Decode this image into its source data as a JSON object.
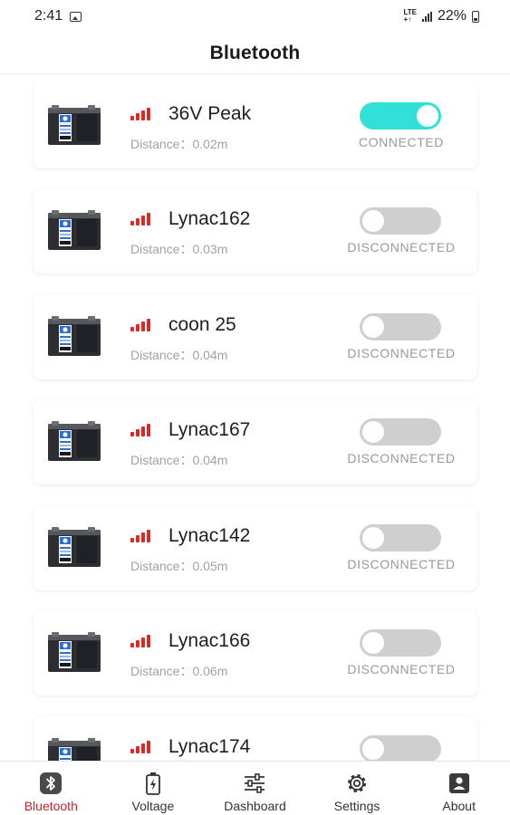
{
  "status_bar": {
    "time": "2:41",
    "lte_top": "LTE",
    "lte_bottom": "+↑",
    "battery": "22%"
  },
  "header": {
    "title": "Bluetooth"
  },
  "devices": [
    {
      "name": "36V Peak",
      "distance": "Distance：0.02m",
      "state": "CONNECTED",
      "connected": true
    },
    {
      "name": "Lynac162",
      "distance": "Distance：0.03m",
      "state": "DISCONNECTED",
      "connected": false
    },
    {
      "name": "coon 25",
      "distance": "Distance：0.04m",
      "state": "DISCONNECTED",
      "connected": false
    },
    {
      "name": "Lynac167",
      "distance": "Distance：0.04m",
      "state": "DISCONNECTED",
      "connected": false
    },
    {
      "name": "Lynac142",
      "distance": "Distance：0.05m",
      "state": "DISCONNECTED",
      "connected": false
    },
    {
      "name": "Lynac166",
      "distance": "Distance：0.06m",
      "state": "DISCONNECTED",
      "connected": false
    },
    {
      "name": "Lynac174",
      "distance": "",
      "state": "",
      "connected": false
    }
  ],
  "bottom_nav": {
    "bluetooth": "Bluetooth",
    "voltage": "Voltage",
    "dashboard": "Dashboard",
    "settings": "Settings",
    "about": "About"
  },
  "colors": {
    "accent": "#c4262b",
    "toggle_on": "#31e0d8",
    "signal": "#d92a26"
  }
}
